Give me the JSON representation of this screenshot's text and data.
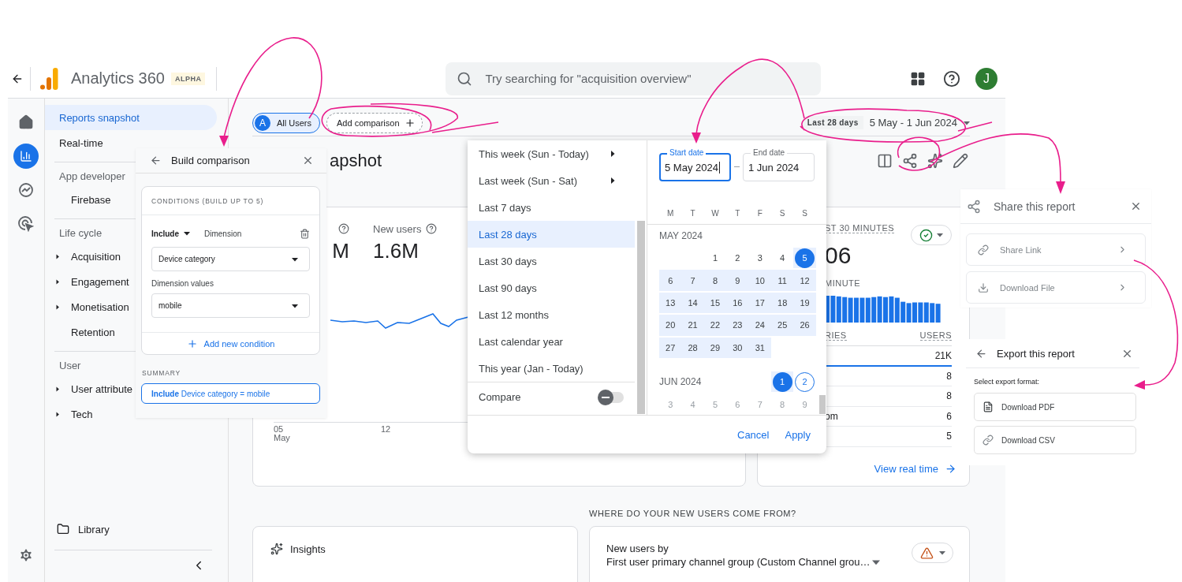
{
  "header": {
    "title": "Analytics 360",
    "badge": "ALPHA",
    "search_placeholder": "Try searching for \"acquisition overview\"",
    "avatar": "J"
  },
  "rail": [
    {
      "kind": "home",
      "selected": false
    },
    {
      "kind": "reports",
      "selected": true
    },
    {
      "kind": "explore",
      "selected": false
    },
    {
      "kind": "advertising",
      "selected": false
    }
  ],
  "nav": {
    "top": [
      {
        "label": "Reports snapshot",
        "selected": true
      },
      {
        "label": "Real-time",
        "selected": false
      }
    ],
    "sections": [
      {
        "title": "App developer",
        "items": [
          {
            "label": "Firebase",
            "expandable": false
          }
        ]
      },
      {
        "title": "Life cycle",
        "items": [
          {
            "label": "Acquisition",
            "expandable": true
          },
          {
            "label": "Engagement",
            "expandable": true
          },
          {
            "label": "Monetisation",
            "expandable": true
          },
          {
            "label": "Retention",
            "expandable": false
          }
        ]
      },
      {
        "title": "User",
        "items": [
          {
            "label": "User attribute",
            "expandable": true
          },
          {
            "label": "Tech",
            "expandable": true
          }
        ]
      }
    ],
    "library": "Library"
  },
  "toolbar": {
    "segment_initial": "A",
    "segment": "All Users",
    "add_comparison": "Add comparison",
    "range_label": "Last 28 days",
    "range": "5 May - 1 Jun 2024"
  },
  "page_title": "apshot",
  "overview_card": {
    "metrics": [
      {
        "value": "M"
      },
      {
        "label": "New users",
        "value": "1.6M"
      }
    ],
    "x_labels": [
      {
        "day": "05",
        "month": "May"
      },
      {
        "day": "12"
      }
    ]
  },
  "realtime_card": {
    "title": "ST 30 MINUTES",
    "value": "06",
    "subtitle": "MINUTE",
    "column_1": "RIES",
    "column_2": "USERS",
    "rows": [
      {
        "value": "21K"
      },
      {
        "value": "8"
      },
      {
        "value": "8"
      },
      {
        "label": "om",
        "value": "6"
      },
      {
        "value": "5"
      }
    ],
    "link": "View real time"
  },
  "insights": {
    "title": "Insights"
  },
  "new_users": {
    "heading": "WHERE DO YOUR NEW USERS COME FROM?",
    "label": "New users by",
    "dimension": "First user primary channel group (Custom Channel grou…"
  },
  "build_comparison": {
    "title": "Build comparison",
    "conditions_heading": "CONDITIONS (BUILD UP TO 5)",
    "include": "Include",
    "dimension_label": "Dimension",
    "dimension": "Device category",
    "values_label": "Dimension values",
    "value": "mobile",
    "add_condition": "Add new condition",
    "summary_heading": "SUMMARY",
    "summary": "**Include** Device category = mobile"
  },
  "date_picker": {
    "presets": [
      {
        "label": "This week (Sun - Today)",
        "submenu": true,
        "selected": false
      },
      {
        "label": "Last week (Sun - Sat)",
        "submenu": true,
        "selected": false
      },
      {
        "label": "Last 7 days",
        "submenu": false,
        "selected": false
      },
      {
        "label": "Last 28 days",
        "submenu": false,
        "selected": true
      },
      {
        "label": "Last 30 days",
        "submenu": false,
        "selected": false
      },
      {
        "label": "Last 90 days",
        "submenu": false,
        "selected": false
      },
      {
        "label": "Last 12 months",
        "submenu": false,
        "selected": false
      },
      {
        "label": "Last calendar year",
        "submenu": false,
        "selected": false
      },
      {
        "label": "This year (Jan - Today)",
        "submenu": false,
        "selected": false
      }
    ],
    "compare": {
      "label": "Compare",
      "on": false
    },
    "start": {
      "label": "Start date",
      "value": "5 May 2024",
      "focused": true
    },
    "end": {
      "label": "End date",
      "value": "1 Jun 2024",
      "focused": false
    },
    "weekdays": [
      "M",
      "T",
      "W",
      "T",
      "F",
      "S",
      "S"
    ],
    "months": [
      {
        "label": "MAY 2024",
        "weeks": [
          [
            {
              "day": "1",
              "kind": "plain"
            },
            {
              "day": "2",
              "kind": "plain"
            },
            {
              "day": "3",
              "kind": "plain"
            },
            {
              "day": "4",
              "kind": "plain"
            },
            {
              "day": "5",
              "kind": "start"
            }
          ],
          [
            {
              "day": "6",
              "kind": "range"
            },
            {
              "day": "7",
              "kind": "range"
            },
            {
              "day": "8",
              "kind": "range"
            },
            {
              "day": "9",
              "kind": "range"
            },
            {
              "day": "10",
              "kind": "range"
            },
            {
              "day": "11",
              "kind": "range"
            },
            {
              "day": "12",
              "kind": "range"
            }
          ],
          [
            {
              "day": "13",
              "kind": "range"
            },
            {
              "day": "14",
              "kind": "range"
            },
            {
              "day": "15",
              "kind": "range"
            },
            {
              "day": "16",
              "kind": "range"
            },
            {
              "day": "17",
              "kind": "range"
            },
            {
              "day": "18",
              "kind": "range"
            },
            {
              "day": "19",
              "kind": "range"
            }
          ],
          [
            {
              "day": "20",
              "kind": "range"
            },
            {
              "day": "21",
              "kind": "range"
            },
            {
              "day": "22",
              "kind": "range"
            },
            {
              "day": "23",
              "kind": "range"
            },
            {
              "day": "24",
              "kind": "range"
            },
            {
              "day": "25",
              "kind": "range"
            },
            {
              "day": "26",
              "kind": "range"
            }
          ],
          [
            {
              "day": "27",
              "kind": "range"
            },
            {
              "day": "28",
              "kind": "range"
            },
            {
              "day": "29",
              "kind": "range"
            },
            {
              "day": "30",
              "kind": "range"
            },
            {
              "day": "31",
              "kind": "range"
            }
          ]
        ]
      },
      {
        "label": "JUN 2024",
        "weeks": [
          [
            {
              "day": "1",
              "kind": "end"
            },
            {
              "day": "2",
              "kind": "today"
            }
          ],
          [
            {
              "day": "3",
              "kind": "disabled"
            },
            {
              "day": "4",
              "kind": "disabled"
            },
            {
              "day": "5",
              "kind": "disabled"
            },
            {
              "day": "6",
              "kind": "disabled"
            },
            {
              "day": "7",
              "kind": "disabled"
            },
            {
              "day": "8",
              "kind": "disabled"
            },
            {
              "day": "9",
              "kind": "disabled"
            }
          ]
        ]
      }
    ],
    "cancel": "Cancel",
    "apply": "Apply"
  },
  "share_panel": {
    "title": "Share this report",
    "options": [
      {
        "kind": "link",
        "label": "Share Link"
      },
      {
        "kind": "download",
        "label": "Download File"
      }
    ]
  },
  "export_panel": {
    "title": "Export this report",
    "prompt": "Select export format:",
    "options": [
      {
        "kind": "pdf",
        "label": "Download PDF"
      },
      {
        "kind": "csv",
        "label": "Download CSV"
      }
    ]
  }
}
